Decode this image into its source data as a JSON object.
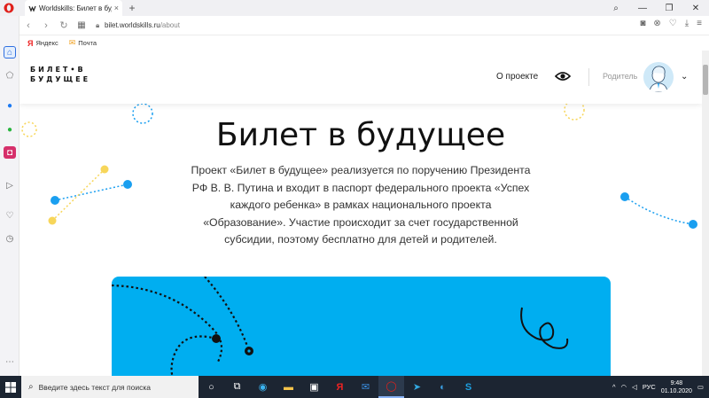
{
  "browser": {
    "tab_title": "Worldskills: Билет в будущ",
    "new_tab": "+",
    "url_host": "bilet.worldskills.ru",
    "url_path": "/about",
    "bookmarks": [
      {
        "label": "Яндекс",
        "icon": "yandex-icon"
      },
      {
        "label": "Почта",
        "icon": "mail-icon"
      }
    ]
  },
  "site": {
    "logo_line1": "БИЛЕТ•В",
    "logo_line2": "БУДУЩЕЕ",
    "nav_about": "О проекте",
    "role": "Родитель"
  },
  "hero": {
    "title": "Билет в будущее",
    "text": "Проект «Билет в будущее» реализуется по поручению Президента РФ В. В. Путина и входит в паспорт федерального проекта «Успех каждого ребенка» в рамках национального проекта «Образование». Участие происходит за счет государственной субсидии, поэтому бесплатно для детей и родителей."
  },
  "taskbar": {
    "search_placeholder": "Введите здесь текст для поиска",
    "lang": "РУС",
    "time": "9:48",
    "date": "01.10.2020"
  },
  "colors": {
    "accent_blue": "#00aef0",
    "dot_blue": "#1a9ff0",
    "dot_yellow": "#f7d65a",
    "opera_red": "#e0201b"
  }
}
